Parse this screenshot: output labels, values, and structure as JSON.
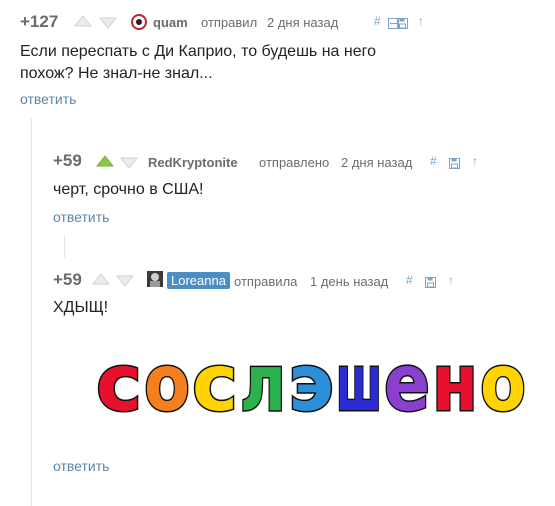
{
  "comments": [
    {
      "score": "+127",
      "author": "quam",
      "action": "отправил",
      "time": "2 дня назад",
      "text_lines": [
        "Если переспать с Ди Каприо, то будешь на него",
        "похож? Не знал-не знал..."
      ],
      "reply": "ответить",
      "icons": [
        "hash-icon",
        "collapse-icon",
        "save-icon",
        "arrow-up-icon"
      ]
    },
    {
      "score": "+59",
      "author": "RedKryptonite",
      "action": "отправлено",
      "time": "2 дня назад",
      "text_lines": [
        "черт, срочно в США!"
      ],
      "reply": "ответить",
      "icons": [
        "hash-icon",
        "save-icon",
        "arrow-up-icon"
      ],
      "upvoted": true
    },
    {
      "score": "+59",
      "author": "Loreanna",
      "action": "отправила",
      "time": "1 день назад",
      "text_lines": [
        "ХДЫЩ!"
      ],
      "reply": "ответить",
      "icons": [
        "hash-icon",
        "save-icon",
        "arrow-up-icon"
      ]
    }
  ],
  "image_word": "сослэшено",
  "letter_colors": [
    "#e8112d",
    "#f57f1f",
    "#ffd400",
    "#2bb24c",
    "#2b8fd9",
    "#2b2bd6",
    "#8a3fcf",
    "#e8112d",
    "#ffd400"
  ],
  "icons": {
    "hash": "#",
    "arrow": "↑"
  },
  "colors": {
    "accent": "#5b87ad",
    "upvote_green": "#8cc63f",
    "meta_gray": "#6d6d6d"
  }
}
